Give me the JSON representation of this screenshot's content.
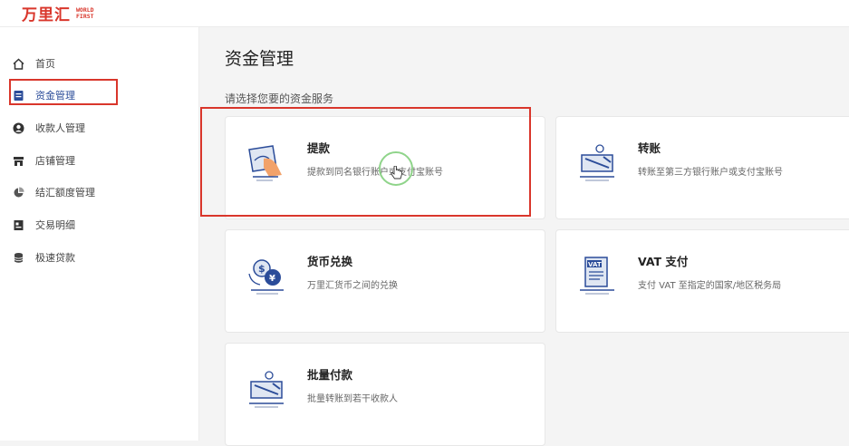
{
  "logo": {
    "cn": "万里汇",
    "en_line1": "WORLD",
    "en_line2": "FIRST"
  },
  "sidebar": {
    "items": [
      {
        "label": "首页",
        "icon": "home-icon"
      },
      {
        "label": "资金管理",
        "icon": "document-icon",
        "active": true
      },
      {
        "label": "收款人管理",
        "icon": "user-icon"
      },
      {
        "label": "店铺管理",
        "icon": "store-icon"
      },
      {
        "label": "结汇额度管理",
        "icon": "pie-chart-icon"
      },
      {
        "label": "交易明细",
        "icon": "ledger-icon"
      },
      {
        "label": "极速贷款",
        "icon": "database-icon"
      }
    ]
  },
  "main": {
    "title": "资金管理",
    "section_label": "请选择您要的资金服务",
    "cards": [
      {
        "title": "提款",
        "desc": "提款到同名银行账户或支付宝账号",
        "icon": "withdraw-icon"
      },
      {
        "title": "转账",
        "desc": "转账至第三方银行账户或支付宝账号",
        "icon": "transfer-icon"
      },
      {
        "title": "货币兑换",
        "desc": "万里汇货币之间的兑换",
        "icon": "currency-exchange-icon"
      },
      {
        "title": "VAT 支付",
        "desc": "支付 VAT 至指定的国家/地区税务局",
        "icon": "vat-icon",
        "icon_text": "VAT"
      },
      {
        "title": "批量付款",
        "desc": "批量转账到若干收款人",
        "icon": "batch-payment-icon"
      }
    ]
  },
  "colors": {
    "brand_red": "#d9362b",
    "accent_blue": "#2b4c99",
    "highlight_green": "#8fd48a"
  }
}
